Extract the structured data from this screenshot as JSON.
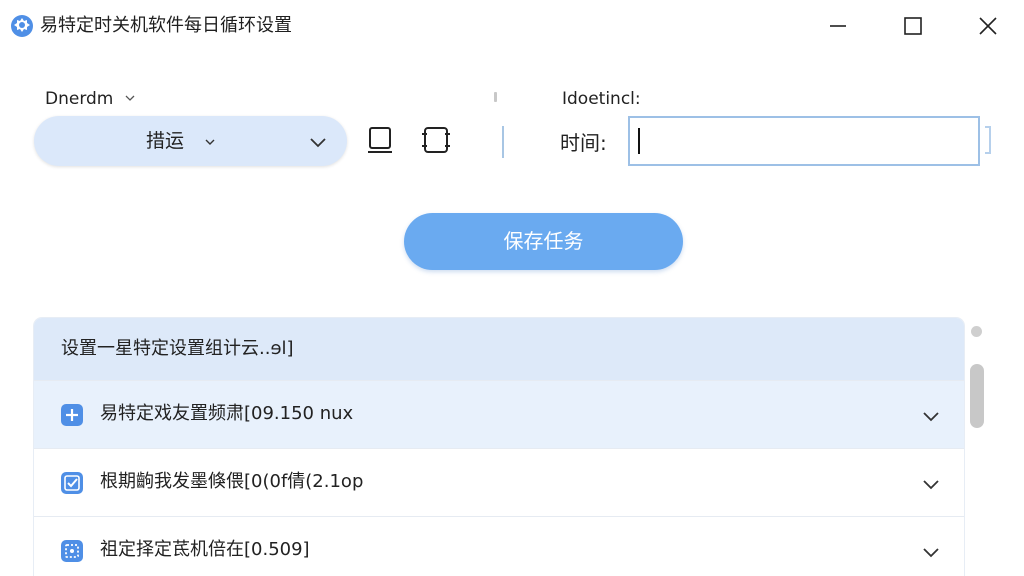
{
  "window": {
    "title": "易特定时关机软件每日循环设置"
  },
  "mode": {
    "label": "Dnerdm",
    "selected": "措运"
  },
  "time": {
    "header": "Idoetincl:",
    "label": "时间:",
    "value": ""
  },
  "actions": {
    "save_label": "保存任务"
  },
  "list": {
    "header": "设置一星特定设置组计云..ɘl]",
    "items": [
      {
        "label": "易特定戏友置频肃[09.150 nux",
        "icon": "plus-square-icon"
      },
      {
        "label": "根期齣我发墨倏偎[0(0f倩(2.1op",
        "icon": "check-square-icon"
      },
      {
        "label": "祖定择定茋机倍在[0.509]",
        "icon": "dotted-square-icon"
      }
    ]
  },
  "colors": {
    "accent": "#6aaaf0",
    "select_bg": "#dbe8fa",
    "header_bg": "#dde9f9",
    "row_active_bg": "#e8f1fc",
    "icon_blue": "#4f8fe6"
  }
}
